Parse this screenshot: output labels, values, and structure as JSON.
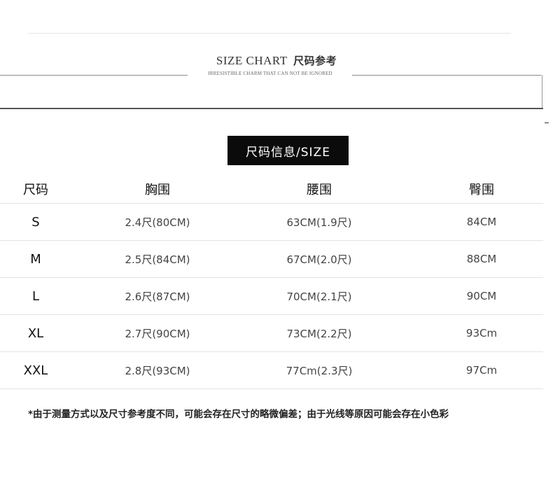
{
  "header": {
    "title_en": "SIZE CHART",
    "title_cn": "尺码参考",
    "subtitle": "IRRESISTIBLE CHARM THAT CAN NOT BE IGNORED"
  },
  "badge": {
    "label": "尺码信息/SIZE"
  },
  "table": {
    "columns": [
      "尺码",
      "胸围",
      "腰围",
      "臀围"
    ],
    "rows": [
      [
        "S",
        "2.4尺(80CM)",
        "63CM(1.9尺)",
        "84CM"
      ],
      [
        "M",
        "2.5尺(84CM)",
        "67CM(2.0尺)",
        "88CM"
      ],
      [
        "L",
        "2.6尺(87CM)",
        "70CM(2.1尺)",
        "90CM"
      ],
      [
        "XL",
        "2.7尺(90CM)",
        "73CM(2.2尺)",
        "93Cm"
      ],
      [
        "XXL",
        "2.8尺(93CM)",
        "77Cm(2.3尺)",
        "97Cm"
      ]
    ]
  },
  "footnote": "*由于测量方式以及尺寸参考度不同，可能会存在尺寸的略微偏差；由于光线等原因可能会存在小色彩"
}
